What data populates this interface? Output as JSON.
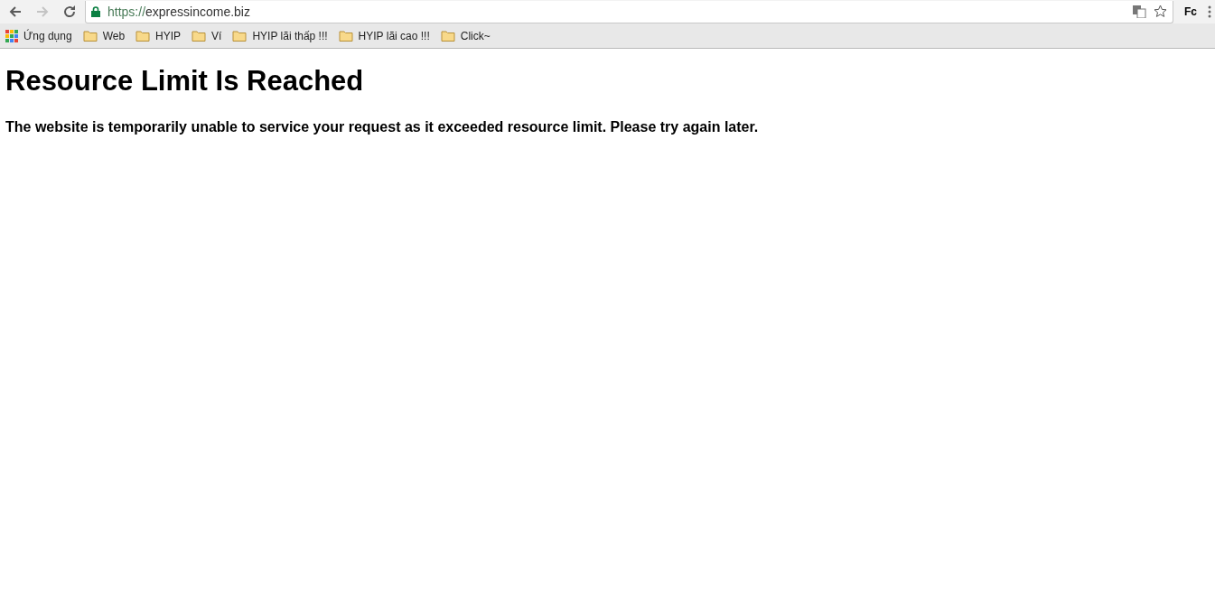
{
  "toolbar": {
    "back": {
      "disabled": false
    },
    "forward": {
      "disabled": true
    },
    "secure": true,
    "url_scheme": "https://",
    "url_host": "expressincome.biz",
    "extension_label": "Fc"
  },
  "bookmarks": [
    {
      "kind": "apps",
      "label": "Ứng dụng"
    },
    {
      "kind": "folder",
      "label": "Web"
    },
    {
      "kind": "folder",
      "label": "HYIP"
    },
    {
      "kind": "folder",
      "label": "Ví"
    },
    {
      "kind": "folder",
      "label": "HYIP lãi thấp !!!"
    },
    {
      "kind": "folder",
      "label": "HYIP lãi cao !!!"
    },
    {
      "kind": "folder",
      "label": "Click~"
    }
  ],
  "page": {
    "heading": "Resource Limit Is Reached",
    "message": "The website is temporarily unable to service your request as it exceeded resource limit. Please try again later."
  }
}
